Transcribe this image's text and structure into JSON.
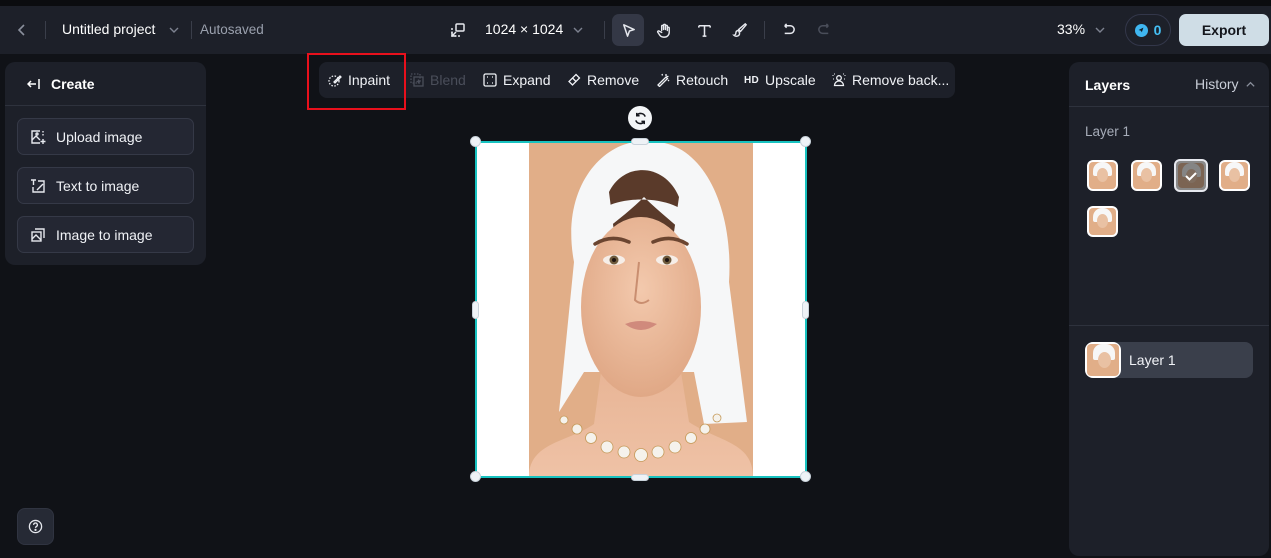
{
  "topbar": {
    "back_icon": "chevron-left-icon",
    "project_title": "Untitled project",
    "save_status": "Autosaved",
    "canvas_size": "1024 × 1024",
    "tools": [
      {
        "name": "select",
        "icon": "pointer-icon",
        "active": true
      },
      {
        "name": "hand",
        "icon": "hand-icon",
        "active": false
      },
      {
        "name": "text",
        "icon": "text-icon",
        "active": false
      },
      {
        "name": "brush",
        "icon": "brush-icon",
        "active": false
      },
      {
        "name": "undo",
        "icon": "undo-icon",
        "active": false
      },
      {
        "name": "redo",
        "icon": "redo-icon",
        "active": false,
        "disabled": true
      }
    ],
    "zoom": "33%",
    "credits": "0",
    "export_label": "Export"
  },
  "create_panel": {
    "title": "Create",
    "buttons": [
      {
        "label": "Upload image",
        "icon": "upload-image-icon"
      },
      {
        "label": "Text to image",
        "icon": "text-to-image-icon"
      },
      {
        "label": "Image to image",
        "icon": "image-to-image-icon"
      }
    ]
  },
  "action_bar": {
    "items": [
      {
        "label": "Inpaint",
        "icon": "inpaint-icon",
        "disabled": false,
        "highlighted": true
      },
      {
        "label": "Blend",
        "icon": "blend-icon",
        "disabled": true
      },
      {
        "label": "Expand",
        "icon": "expand-icon",
        "disabled": false
      },
      {
        "label": "Remove",
        "icon": "eraser-icon",
        "disabled": false
      },
      {
        "label": "Retouch",
        "icon": "magic-wand-icon",
        "disabled": false
      },
      {
        "label": "Upscale",
        "icon": "hd-icon",
        "icon_text": "HD",
        "disabled": false
      },
      {
        "label": "Remove back...",
        "icon": "remove-background-icon",
        "disabled": false
      }
    ]
  },
  "canvas": {
    "image_description": "Portrait of woman with white towel on head wearing diamond necklace",
    "selection_color": "#18c2c0"
  },
  "layers_panel": {
    "tab_layers": "Layers",
    "tab_history": "History",
    "history_group_label": "Layer 1",
    "history_thumbnails": [
      {
        "selected": false
      },
      {
        "selected": false
      },
      {
        "selected": true
      },
      {
        "selected": false
      },
      {
        "selected": false
      }
    ],
    "layers": [
      {
        "name": "Layer 1"
      }
    ]
  },
  "help_icon": "question-circle-icon",
  "colors": {
    "accent": "#18c2c0",
    "export_bg": "#cfdde6",
    "highlight": "#e8101c",
    "credits": "#45c0f5"
  }
}
